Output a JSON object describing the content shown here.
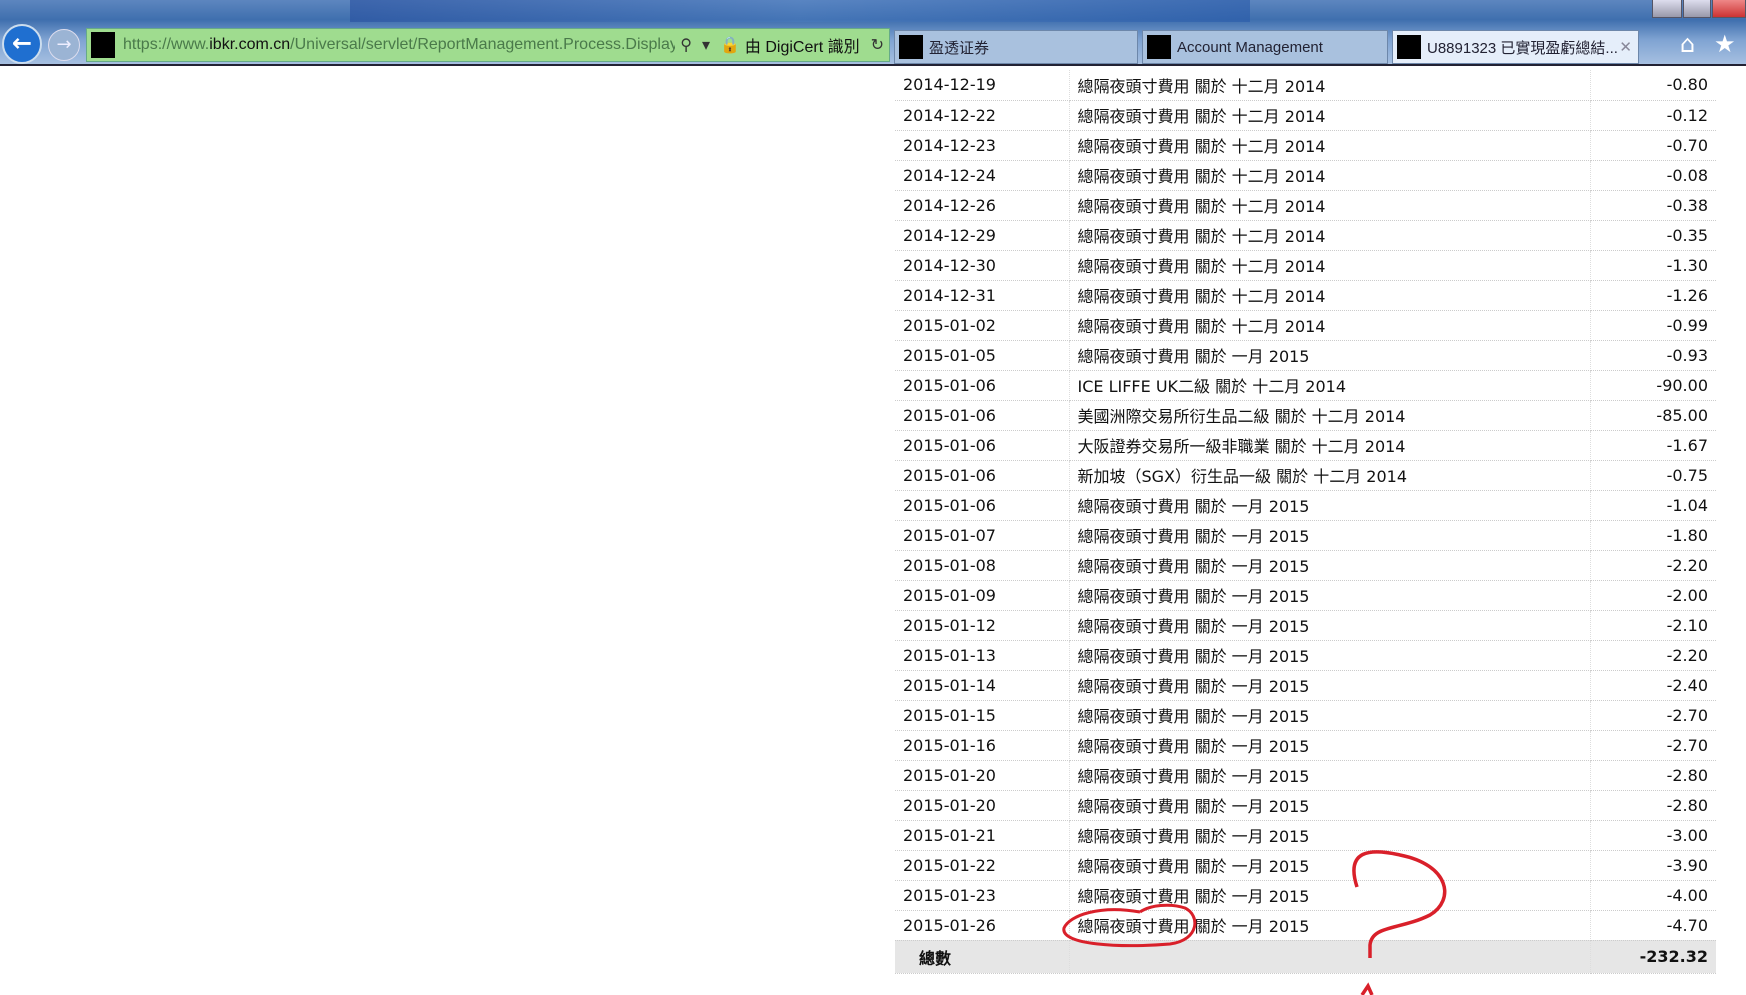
{
  "browser": {
    "url_prefix": "https://www.",
    "url_domain": "ibkr.com.cn",
    "url_path": "/Universal/servlet/ReportManagement.Process.Display",
    "cert": "由 DigiCert 識別",
    "tabs": [
      {
        "label": "盈透证券"
      },
      {
        "label": "Account Management"
      },
      {
        "label": "U8891323 已實現盈虧總結..."
      }
    ]
  },
  "table": {
    "rows": [
      [
        "2014-12-19",
        "總隔夜頭寸費用 關於 十二月 2014",
        "-0.80"
      ],
      [
        "2014-12-22",
        "總隔夜頭寸費用 關於 十二月 2014",
        "-0.12"
      ],
      [
        "2014-12-23",
        "總隔夜頭寸費用 關於 十二月 2014",
        "-0.70"
      ],
      [
        "2014-12-24",
        "總隔夜頭寸費用 關於 十二月 2014",
        "-0.08"
      ],
      [
        "2014-12-26",
        "總隔夜頭寸費用 關於 十二月 2014",
        "-0.38"
      ],
      [
        "2014-12-29",
        "總隔夜頭寸費用 關於 十二月 2014",
        "-0.35"
      ],
      [
        "2014-12-30",
        "總隔夜頭寸費用 關於 十二月 2014",
        "-1.30"
      ],
      [
        "2014-12-31",
        "總隔夜頭寸費用 關於 十二月 2014",
        "-1.26"
      ],
      [
        "2015-01-02",
        "總隔夜頭寸費用 關於 十二月 2014",
        "-0.99"
      ],
      [
        "2015-01-05",
        "總隔夜頭寸費用 關於 一月 2015",
        "-0.93"
      ],
      [
        "2015-01-06",
        "ICE LIFFE UK二級 關於 十二月 2014",
        "-90.00"
      ],
      [
        "2015-01-06",
        "美國洲際交易所衍生品二級 關於 十二月 2014",
        "-85.00"
      ],
      [
        "2015-01-06",
        "大阪證券交易所一級非職業 關於 十二月 2014",
        "-1.67"
      ],
      [
        "2015-01-06",
        "新加坡（SGX）衍生品一級 關於 十二月 2014",
        "-0.75"
      ],
      [
        "2015-01-06",
        "總隔夜頭寸費用 關於 一月 2015",
        "-1.04"
      ],
      [
        "2015-01-07",
        "總隔夜頭寸費用 關於 一月 2015",
        "-1.80"
      ],
      [
        "2015-01-08",
        "總隔夜頭寸費用 關於 一月 2015",
        "-2.20"
      ],
      [
        "2015-01-09",
        "總隔夜頭寸費用 關於 一月 2015",
        "-2.00"
      ],
      [
        "2015-01-12",
        "總隔夜頭寸費用 關於 一月 2015",
        "-2.10"
      ],
      [
        "2015-01-13",
        "總隔夜頭寸費用 關於 一月 2015",
        "-2.20"
      ],
      [
        "2015-01-14",
        "總隔夜頭寸費用 關於 一月 2015",
        "-2.40"
      ],
      [
        "2015-01-15",
        "總隔夜頭寸費用 關於 一月 2015",
        "-2.70"
      ],
      [
        "2015-01-16",
        "總隔夜頭寸費用 關於 一月 2015",
        "-2.70"
      ],
      [
        "2015-01-20",
        "總隔夜頭寸費用 關於 一月 2015",
        "-2.80"
      ],
      [
        "2015-01-20",
        "總隔夜頭寸費用 關於 一月 2015",
        "-2.80"
      ],
      [
        "2015-01-21",
        "總隔夜頭寸費用 關於 一月 2015",
        "-3.00"
      ],
      [
        "2015-01-22",
        "總隔夜頭寸費用 關於 一月 2015",
        "-3.90"
      ],
      [
        "2015-01-23",
        "總隔夜頭寸費用 關於 一月 2015",
        "-4.00"
      ],
      [
        "2015-01-26",
        "總隔夜頭寸費用 關於 一月 2015",
        "-4.70"
      ]
    ],
    "total_label": "總數",
    "total_value": "-232.32"
  },
  "colors": {
    "annotation": "#d9202a",
    "address_bar": "#9fdc8f"
  }
}
